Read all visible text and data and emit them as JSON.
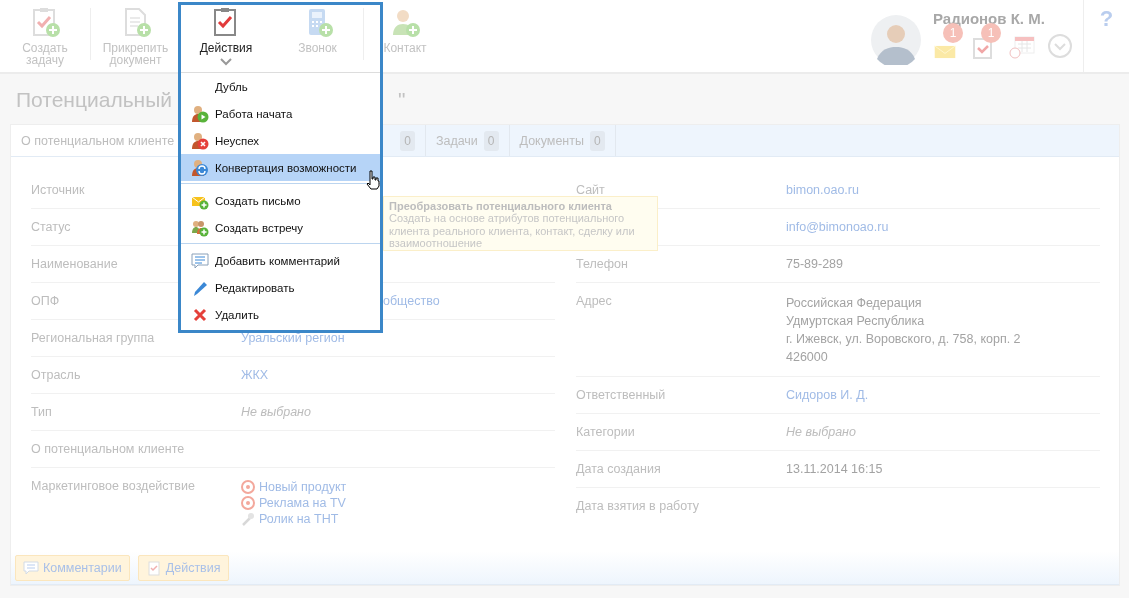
{
  "toolbar": [
    {
      "kind": "task",
      "label": "Создать задачу",
      "open": false
    },
    {
      "kind": "attach",
      "label": "Прикрепить документ",
      "open": false
    },
    {
      "kind": "actions",
      "label": "Действия",
      "open": true
    },
    {
      "kind": "call",
      "label": "Звонок",
      "open": false
    },
    {
      "kind": "contact",
      "label": "Контакт",
      "open": false
    }
  ],
  "user": {
    "name": "Радионов К. М.",
    "notifications": [
      {
        "kind": "mail",
        "count": "1"
      },
      {
        "kind": "tasks",
        "count": "1"
      },
      {
        "kind": "calendar"
      },
      {
        "kind": "more"
      }
    ],
    "help": "?"
  },
  "title": {
    "head": "Потенциальный",
    "tail": "\""
  },
  "tabs": [
    {
      "label": "О потенциальном клиенте",
      "selected": true
    },
    {
      "count": "0",
      "selected": false
    },
    {
      "label": "Задачи",
      "count": "0",
      "selected": false
    },
    {
      "label": "Документы",
      "count": "0",
      "selected": false
    }
  ],
  "left_fields": [
    {
      "label": "Источник"
    },
    {
      "label": "Статус"
    },
    {
      "label": "Наименование"
    },
    {
      "label": "ОПФ",
      "values": [
        {
          "text": "общество",
          "kind": "link",
          "cut": true
        }
      ]
    },
    {
      "label": "Региональная группа",
      "values": [
        {
          "text": "Уральский регион",
          "kind": "link"
        }
      ]
    },
    {
      "label": "Отрасль",
      "values": [
        {
          "text": "ЖКХ",
          "kind": "link"
        }
      ]
    },
    {
      "label": "Тип",
      "values": [
        {
          "text": "Не выбрано",
          "kind": "placeholder"
        }
      ]
    },
    {
      "label": "О потенциальном клиенте"
    },
    {
      "label": "Маркетинговое воздействие",
      "values": [
        {
          "text": "Новый продукт",
          "kind": "target"
        },
        {
          "text": "Реклама на TV",
          "kind": "target"
        },
        {
          "text": "Ролик на ТНТ",
          "kind": "tool"
        }
      ]
    }
  ],
  "right_fields": [
    {
      "label": "Сайт",
      "values": [
        {
          "text": "bimon.oao.ru",
          "kind": "link"
        }
      ]
    },
    {
      "values": [
        {
          "text": "info@bimonoao.ru",
          "kind": "link"
        }
      ]
    },
    {
      "label": "Телефон",
      "values": [
        {
          "text": "75-89-289",
          "kind": "plain"
        }
      ]
    },
    {
      "label": "Адрес",
      "values": [
        {
          "text": "Российская Федерация",
          "kind": "plain"
        },
        {
          "text": "Удмуртская Республика",
          "kind": "plain"
        },
        {
          "text": "г. Ижевск, ул. Воровского, д. 758, корп. 2",
          "kind": "plain"
        },
        {
          "text": "426000",
          "kind": "plain"
        }
      ]
    },
    {
      "label": "Ответственный",
      "values": [
        {
          "text": "Сидоров И. Д.",
          "kind": "link"
        }
      ]
    },
    {
      "label": "Категории",
      "values": [
        {
          "text": "Не выбрано",
          "kind": "placeholder"
        }
      ]
    },
    {
      "label": "Дата создания",
      "values": [
        {
          "text": "13.11.2014 16:15",
          "kind": "plain"
        }
      ]
    },
    {
      "label": "Дата взятия в работу"
    }
  ],
  "footer_buttons": [
    {
      "kind": "comment",
      "label": "Комментарии"
    },
    {
      "kind": "actions",
      "label": "Действия"
    }
  ],
  "menu": [
    [
      {
        "kind": "duplicate",
        "label": "Дубль",
        "selected": false
      },
      {
        "kind": "started",
        "label": "Работа начата",
        "selected": false
      },
      {
        "kind": "failed",
        "label": "Неуспех",
        "selected": false
      },
      {
        "kind": "convert",
        "label": "Конвертация возможности",
        "selected": true
      }
    ],
    [
      {
        "kind": "letter",
        "label": "Создать письмо",
        "selected": false
      },
      {
        "kind": "meeting",
        "label": "Создать встречу",
        "selected": false
      }
    ],
    [
      {
        "kind": "comment",
        "label": "Добавить комментарий",
        "selected": false
      },
      {
        "kind": "edit",
        "label": "Редактировать",
        "selected": false
      },
      {
        "kind": "delete",
        "label": "Удалить",
        "selected": false
      }
    ]
  ],
  "tooltip": {
    "title": "Преобразовать потенциального клиента",
    "text": "Создать на основе атрибутов потенциального клиента реального клиента, контакт, сделку или взаимоотношение"
  }
}
